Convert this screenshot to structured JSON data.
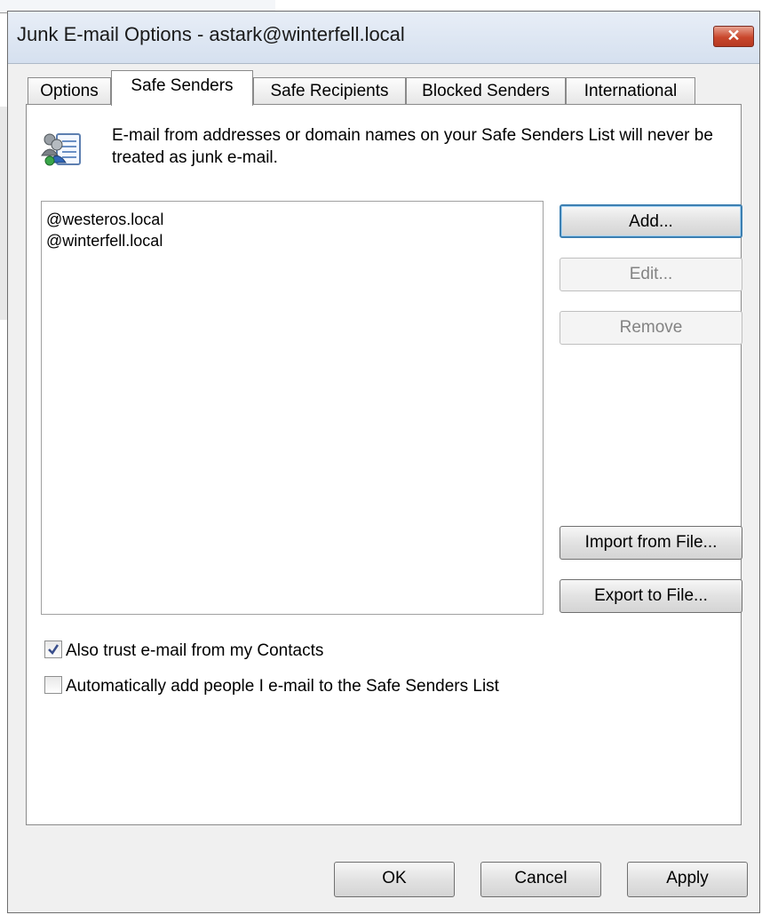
{
  "window": {
    "title": "Junk E-mail Options - astark@winterfell.local",
    "close_label": "✕"
  },
  "tabs": [
    {
      "label": "Options"
    },
    {
      "label": "Safe Senders",
      "active": true
    },
    {
      "label": "Safe Recipients"
    },
    {
      "label": "Blocked Senders"
    },
    {
      "label": "International"
    }
  ],
  "panel": {
    "icon": "contacts-list-icon",
    "description": "E-mail from addresses or domain names on your Safe Senders List will never be treated as junk e-mail.",
    "list": [
      "@westeros.local",
      "@winterfell.local"
    ],
    "buttons": {
      "add": "Add...",
      "edit": "Edit...",
      "remove": "Remove",
      "import": "Import from File...",
      "export": "Export to File..."
    },
    "checkboxes": [
      {
        "label": "Also trust e-mail from my Contacts",
        "checked": true
      },
      {
        "label": "Automatically add people I e-mail to the Safe Senders List",
        "checked": false
      }
    ]
  },
  "footer": {
    "ok": "OK",
    "cancel": "Cancel",
    "apply": "Apply"
  }
}
